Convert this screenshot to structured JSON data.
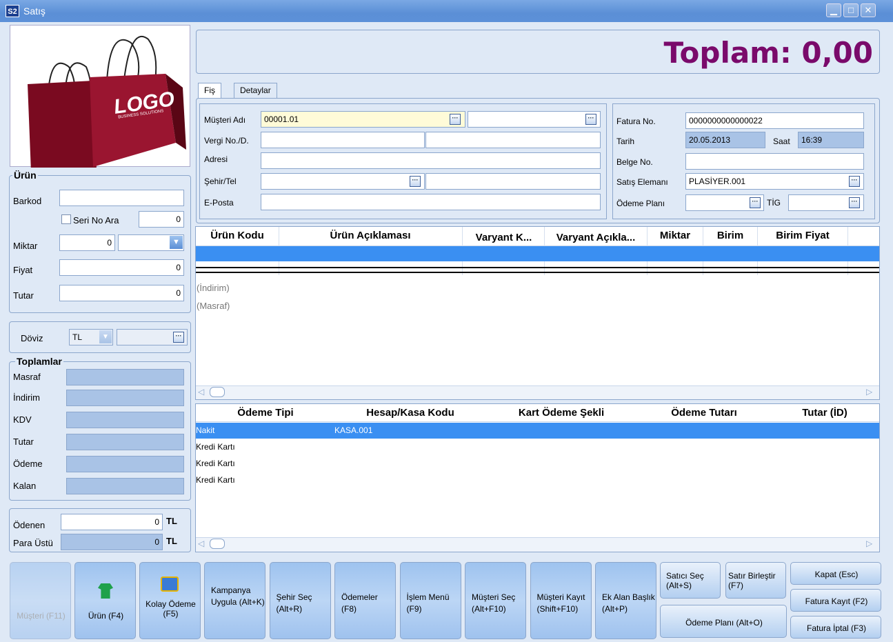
{
  "window": {
    "title": "Satış",
    "logo": "S2"
  },
  "total": {
    "label": "Toplam: 0,00",
    "color": "#7a0a6b"
  },
  "brand": {
    "logo_text": "LOGO",
    "sub_text": "BUSINESS SOLUTIONS"
  },
  "product": {
    "group_title": "Ürün",
    "barcode_label": "Barkod",
    "barcode_value": "",
    "serial_search_label": "Seri No Ara",
    "serial_value": "0",
    "quantity_label": "Miktar",
    "quantity_value": "0",
    "unit_value": "",
    "price_label": "Fiyat",
    "price_value": "0",
    "amount_label": "Tutar",
    "amount_value": "0"
  },
  "currency": {
    "label": "Döviz",
    "value": "TL",
    "rate": ""
  },
  "totals": {
    "group_title": "Toplamlar",
    "rows": [
      {
        "label": "Masraf"
      },
      {
        "label": "İndirim"
      },
      {
        "label": "KDV"
      },
      {
        "label": "Tutar"
      },
      {
        "label": "Ödeme"
      },
      {
        "label": "Kalan"
      }
    ]
  },
  "paid": {
    "paid_label": "Ödenen",
    "paid_value": "0",
    "paid_unit": "TL",
    "change_label": "Para Üstü",
    "change_value": "0",
    "change_unit": "TL"
  },
  "tabs": [
    {
      "label": "Fiş"
    },
    {
      "label": "Detaylar"
    }
  ],
  "customer": {
    "name_label": "Müşteri Adı",
    "name_code": "00001.01",
    "name_value": "",
    "tax_label": "Vergi No./D.",
    "tax_no": "",
    "tax_office": "",
    "address_label": "Adresi",
    "address": "",
    "city_label": "Şehir/Tel",
    "city": "",
    "phone": "",
    "email_label": "E-Posta",
    "email": ""
  },
  "invoice": {
    "no_label": "Fatura No.",
    "no_value": "0000000000000022",
    "date_label": "Tarih",
    "date_value": "20.05.2013",
    "time_label": "Saat",
    "time_value": "16:39",
    "doc_label": "Belge No.",
    "doc_value": "",
    "sales_label": "Satış Elemanı",
    "sales_value": "PLASİYER.001",
    "plan_label": "Ödeme Planı",
    "plan_value": "",
    "tig_label": "TİG",
    "tig_value": ""
  },
  "items_table": {
    "columns": [
      "Ürün Kodu",
      "Ürün Açıklaması",
      "Varyant K...",
      "Varyant Açıkla...",
      "Miktar",
      "Birim",
      "Birim Fiyat"
    ],
    "footer_rows": [
      "(İndirim)",
      "(Masraf)"
    ]
  },
  "payments_table": {
    "columns": [
      "Ödeme Tipi",
      "Hesap/Kasa Kodu",
      "Kart Ödeme Şekli",
      "Ödeme Tutarı",
      "Tutar (İD)"
    ],
    "rows": [
      {
        "type": "Nakit",
        "account": "KASA.001"
      },
      {
        "type": "Kredi Kartı",
        "account": ""
      },
      {
        "type": "Kredi Kartı",
        "account": ""
      },
      {
        "type": "Kredi Kartı",
        "account": ""
      }
    ]
  },
  "buttons": {
    "customer": "Müşteri (F11)",
    "product": "Ürün (F4)",
    "easy_pay": "Kolay Ödeme (F5)",
    "campaign": "Kampanya Uygula (Alt+K)",
    "city": "Şehir Seç (Alt+R)",
    "payments": "Ödemeler (F8)",
    "menu": "İşlem Menü (F9)",
    "select_customer": "Müşteri Seç (Alt+F10)",
    "save_customer": "Müşteri Kayıt (Shift+F10)",
    "extra_field": "Ek Alan Başlık (Alt+P)",
    "seller": "Satıcı Seç (Alt+S)",
    "merge": "Satır Birleştir (F7)",
    "plan": "Ödeme Planı (Alt+O)",
    "close": "Kapat (Esc)",
    "save_invoice": "Fatura Kayıt (F2)",
    "cancel_invoice": "Fatura İptal (F3)"
  }
}
